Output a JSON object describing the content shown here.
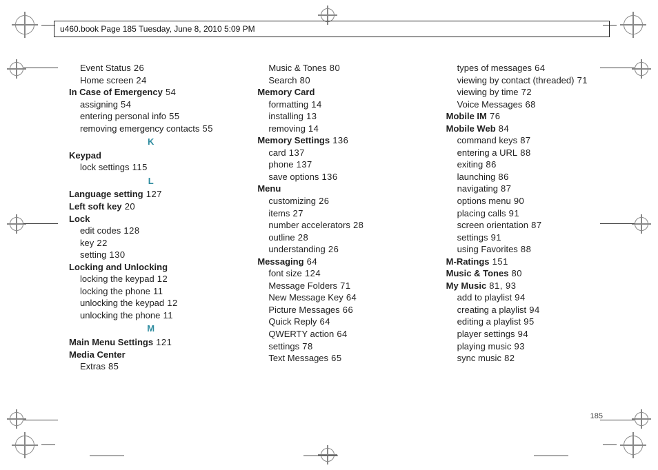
{
  "header": "u460.book  Page 185  Tuesday, June 8, 2010  5:09 PM",
  "page_number": "185",
  "columns": [
    [
      {
        "t": "sub",
        "text": "Event Status",
        "num": "26"
      },
      {
        "t": "sub",
        "text": "Home screen",
        "num": "24"
      },
      {
        "t": "bold",
        "text": "In Case of Emergency",
        "num": "54"
      },
      {
        "t": "sub",
        "text": "assigning",
        "num": "54"
      },
      {
        "t": "sub",
        "text": "entering personal info",
        "num": "55"
      },
      {
        "t": "sub",
        "text": "removing emergency contacts",
        "num": "55"
      },
      {
        "t": "letter",
        "text": "K"
      },
      {
        "t": "bold",
        "text": "Keypad"
      },
      {
        "t": "sub",
        "text": "lock settings",
        "num": "115"
      },
      {
        "t": "letter",
        "text": "L"
      },
      {
        "t": "bold",
        "text": "Language setting",
        "num": "127"
      },
      {
        "t": "bold",
        "text": "Left soft key",
        "num": "20"
      },
      {
        "t": "bold",
        "text": "Lock"
      },
      {
        "t": "sub",
        "text": "edit codes",
        "num": "128"
      },
      {
        "t": "sub",
        "text": "key",
        "num": "22"
      },
      {
        "t": "sub",
        "text": "setting",
        "num": "130"
      },
      {
        "t": "bold",
        "text": "Locking and Unlocking"
      },
      {
        "t": "sub",
        "text": "locking the keypad",
        "num": "12"
      },
      {
        "t": "sub",
        "text": "locking the phone",
        "num": "11"
      },
      {
        "t": "sub",
        "text": "unlocking the keypad",
        "num": "12"
      },
      {
        "t": "sub",
        "text": "unlocking the phone",
        "num": "11"
      },
      {
        "t": "letter",
        "text": "M"
      },
      {
        "t": "bold",
        "text": "Main Menu Settings",
        "num": "121"
      },
      {
        "t": "bold",
        "text": "Media Center"
      },
      {
        "t": "sub",
        "text": "Extras",
        "num": "85"
      }
    ],
    [
      {
        "t": "sub",
        "text": "Music & Tones",
        "num": "80"
      },
      {
        "t": "sub",
        "text": "Search",
        "num": "80"
      },
      {
        "t": "bold",
        "text": "Memory Card"
      },
      {
        "t": "sub",
        "text": "formatting",
        "num": "14"
      },
      {
        "t": "sub",
        "text": "installing",
        "num": "13"
      },
      {
        "t": "sub",
        "text": "removing",
        "num": "14"
      },
      {
        "t": "bold",
        "text": "Memory Settings",
        "num": "136"
      },
      {
        "t": "sub",
        "text": "card",
        "num": "137"
      },
      {
        "t": "sub",
        "text": "phone",
        "num": "137"
      },
      {
        "t": "sub",
        "text": "save options",
        "num": "136"
      },
      {
        "t": "bold",
        "text": "Menu"
      },
      {
        "t": "sub",
        "text": "customizing",
        "num": "26"
      },
      {
        "t": "sub",
        "text": "items",
        "num": "27"
      },
      {
        "t": "sub",
        "text": "number accelerators",
        "num": "28"
      },
      {
        "t": "sub",
        "text": "outline",
        "num": "28"
      },
      {
        "t": "sub",
        "text": "understanding",
        "num": "26"
      },
      {
        "t": "bold",
        "text": "Messaging",
        "num": "64"
      },
      {
        "t": "sub",
        "text": "font size",
        "num": "124"
      },
      {
        "t": "sub",
        "text": "Message Folders",
        "num": "71"
      },
      {
        "t": "sub",
        "text": "New Message Key",
        "num": "64"
      },
      {
        "t": "sub",
        "text": "Picture Messages",
        "num": "66"
      },
      {
        "t": "sub",
        "text": "Quick Reply",
        "num": "64"
      },
      {
        "t": "sub",
        "text": "QWERTY action",
        "num": "64"
      },
      {
        "t": "sub",
        "text": "settings",
        "num": "78"
      },
      {
        "t": "sub",
        "text": "Text Messages",
        "num": "65"
      }
    ],
    [
      {
        "t": "sub",
        "text": "types of messages",
        "num": "64"
      },
      {
        "t": "sub",
        "text": "viewing by contact (threaded)",
        "num": "71"
      },
      {
        "t": "sub",
        "text": "viewing by time",
        "num": "72"
      },
      {
        "t": "sub",
        "text": "Voice Messages",
        "num": "68"
      },
      {
        "t": "bold",
        "text": "Mobile IM",
        "num": "76"
      },
      {
        "t": "bold",
        "text": "Mobile Web",
        "num": "84"
      },
      {
        "t": "sub",
        "text": "command keys",
        "num": "87"
      },
      {
        "t": "sub",
        "text": "entering a URL",
        "num": "88"
      },
      {
        "t": "sub",
        "text": "exiting",
        "num": "86"
      },
      {
        "t": "sub",
        "text": "launching",
        "num": "86"
      },
      {
        "t": "sub",
        "text": "navigating",
        "num": "87"
      },
      {
        "t": "sub",
        "text": "options menu",
        "num": "90"
      },
      {
        "t": "sub",
        "text": "placing calls",
        "num": "91"
      },
      {
        "t": "sub",
        "text": "screen orientation",
        "num": "87"
      },
      {
        "t": "sub",
        "text": "settings",
        "num": "91"
      },
      {
        "t": "sub",
        "text": "using Favorites",
        "num": "88"
      },
      {
        "t": "bold",
        "text": "M-Ratings",
        "num": "151"
      },
      {
        "t": "bold",
        "text": "Music & Tones",
        "num": "80"
      },
      {
        "t": "bold",
        "text": "My Music",
        "num": "81, 93"
      },
      {
        "t": "sub",
        "text": "add to playlist",
        "num": "94"
      },
      {
        "t": "sub",
        "text": "creating a playlist",
        "num": "94"
      },
      {
        "t": "sub",
        "text": "editing a playlist",
        "num": "95"
      },
      {
        "t": "sub",
        "text": "player settings",
        "num": "94"
      },
      {
        "t": "sub",
        "text": "playing music",
        "num": "93"
      },
      {
        "t": "sub",
        "text": "sync music",
        "num": "82"
      }
    ]
  ]
}
